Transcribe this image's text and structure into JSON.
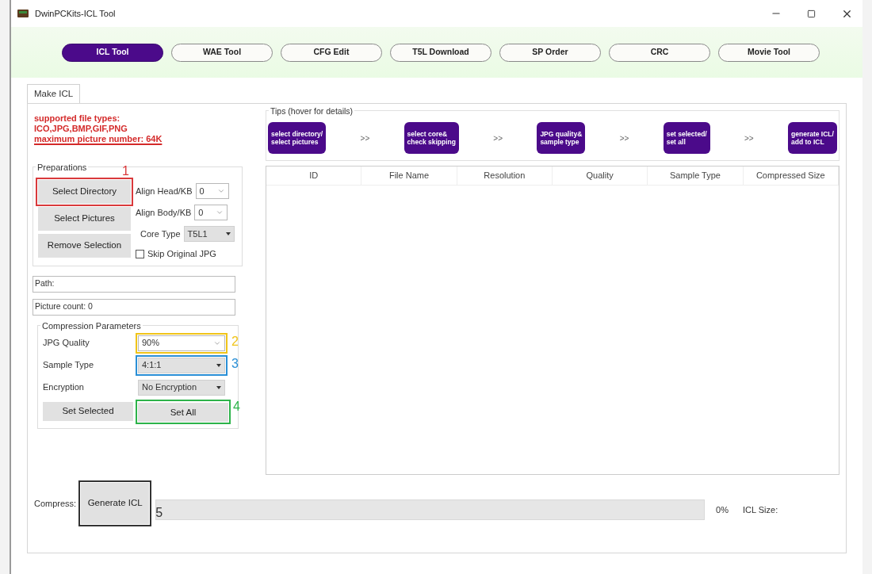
{
  "window": {
    "title": "DwinPCKits-ICL Tool"
  },
  "nav_buttons": [
    {
      "label": "ICL Tool",
      "selected": true
    },
    {
      "label": "WAE Tool",
      "selected": false
    },
    {
      "label": "CFG Edit",
      "selected": false
    },
    {
      "label": "T5L Download",
      "selected": false
    },
    {
      "label": "SP Order",
      "selected": false
    },
    {
      "label": "CRC",
      "selected": false
    },
    {
      "label": "Movie Tool",
      "selected": false
    }
  ],
  "tabs": [
    {
      "label": "Make ICL",
      "selected": true
    }
  ],
  "notice": [
    {
      "text": "supported file types:",
      "underlined": false
    },
    {
      "text": "ICO,JPG,BMP,GIF,PNG",
      "underlined": false
    },
    {
      "text": "maximum picture number: 64K",
      "underlined": true
    }
  ],
  "preparations": {
    "title": "Preparations",
    "buttons": [
      {
        "label": "Select Directory",
        "annotation": {
          "number": "1",
          "color": "#d9393b"
        }
      },
      {
        "label": "Select Pictures"
      },
      {
        "label": "Remove Selection"
      }
    ],
    "options": [
      {
        "kind": "combo",
        "label": "Align Head/KB",
        "value": "0"
      },
      {
        "kind": "combo",
        "label": "Align Body/KB",
        "value": "0"
      },
      {
        "kind": "dropdown",
        "label": "Core Type",
        "value": "T5L1"
      },
      {
        "kind": "checkbox",
        "label": "Skip Original JPG",
        "checked": false
      }
    ]
  },
  "path_field": {
    "value": "Path:"
  },
  "picture_count_field": {
    "value": "Picture count: 0"
  },
  "compression": {
    "title": "Compression Parameters",
    "rows": [
      {
        "kind": "combo",
        "label": "JPG Quality",
        "value": "90%",
        "annotation": {
          "number": "2",
          "color": "#f0c419"
        }
      },
      {
        "kind": "dropdown",
        "label": "Sample Type",
        "value": "4:1:1",
        "annotation": {
          "number": "3",
          "color": "#2a8fd6"
        }
      },
      {
        "kind": "dropdown",
        "label": "Encryption",
        "value": "No Encryption"
      }
    ],
    "buttons": [
      {
        "label": "Set Selected"
      },
      {
        "label": "Set All",
        "annotation": {
          "number": "4",
          "color": "#2db34a"
        }
      }
    ]
  },
  "tips": {
    "title": "Tips (hover for details)",
    "items": [
      {
        "kind": "step",
        "text": "select directory/\nselect pictures"
      },
      {
        "kind": "separator",
        "text": ">>"
      },
      {
        "kind": "step",
        "text": "select core&\ncheck skipping"
      },
      {
        "kind": "separator",
        "text": ">>"
      },
      {
        "kind": "step",
        "text": "JPG quality&\nsample type"
      },
      {
        "kind": "separator",
        "text": ">>"
      },
      {
        "kind": "step",
        "text": "set selected/\nset all"
      },
      {
        "kind": "separator",
        "text": ">>"
      },
      {
        "kind": "step",
        "text": "generate ICL/\nadd to ICL"
      }
    ]
  },
  "table": {
    "columns": [
      "ID",
      "File Name",
      "Resolution",
      "Quality",
      "Sample Type",
      "Compressed Size"
    ]
  },
  "footer": {
    "label": "Compress:",
    "button": {
      "label": "Generate ICL",
      "annotation": {
        "number": "5",
        "color": "#333333"
      }
    },
    "progress": {
      "level": 0
    },
    "percent": "0%",
    "icl_size_label": "ICL Size:"
  }
}
